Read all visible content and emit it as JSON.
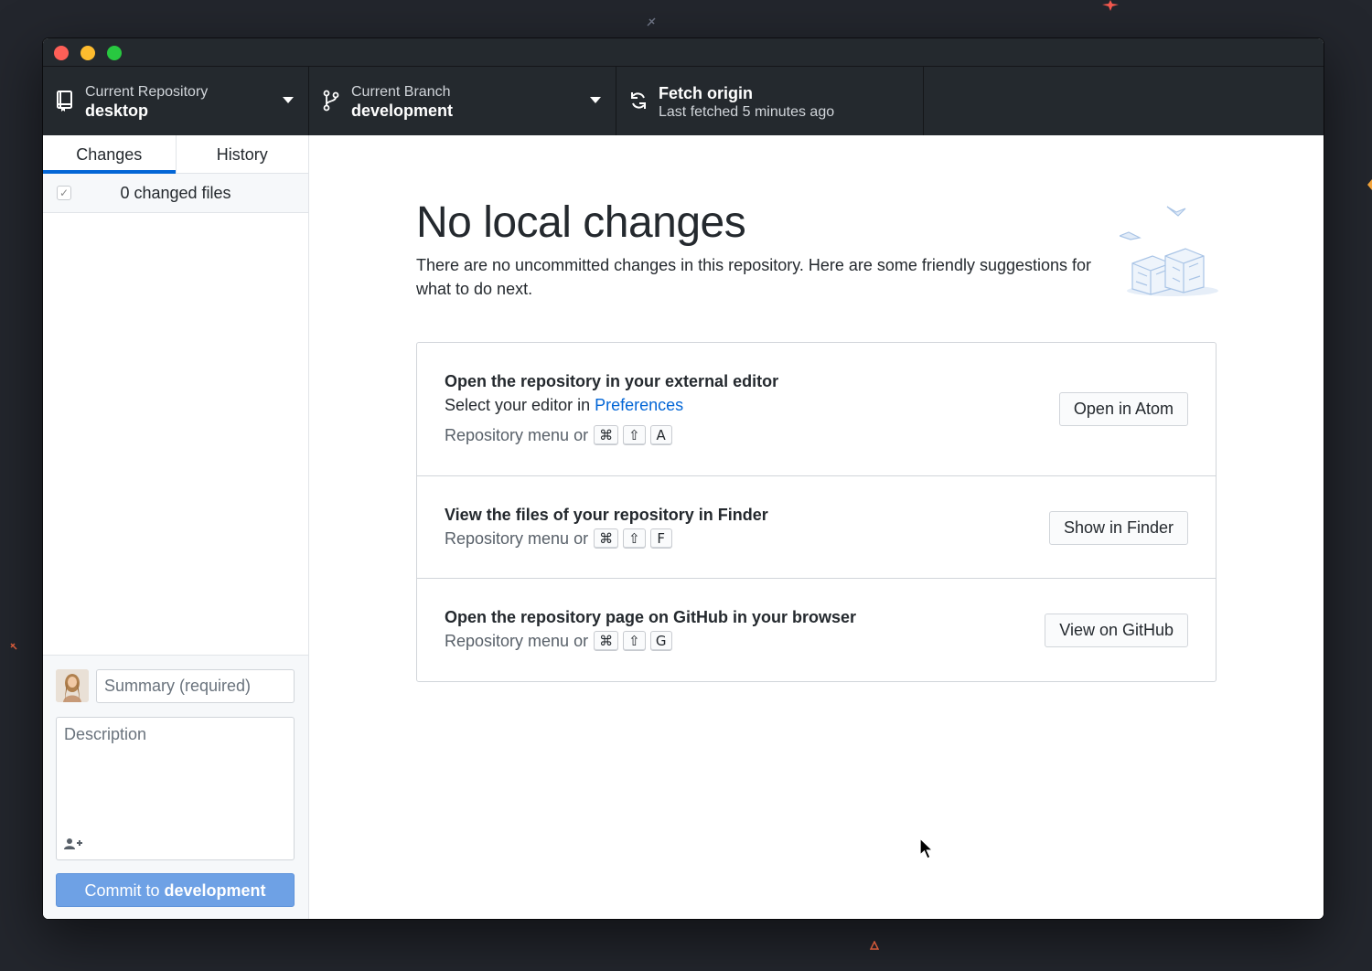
{
  "toolbar": {
    "repo": {
      "label": "Current Repository",
      "value": "desktop"
    },
    "branch": {
      "label": "Current Branch",
      "value": "development"
    },
    "fetch": {
      "label": "Fetch origin",
      "status": "Last fetched 5 minutes ago"
    }
  },
  "sidebar": {
    "tabs": [
      {
        "label": "Changes",
        "active": true
      },
      {
        "label": "History",
        "active": false
      }
    ],
    "changed_files": "0 changed files",
    "summary_placeholder": "Summary (required)",
    "description_placeholder": "Description",
    "commit": {
      "prefix": "Commit to ",
      "branch": "development"
    }
  },
  "main": {
    "title": "No local changes",
    "subtitle": "There are no uncommitted changes in this repository. Here are some friendly suggestions for what to do next.",
    "shortcut_prefix": "Repository menu or",
    "actions": [
      {
        "title": "Open the repository in your external editor",
        "line_prefix": "Select your editor in ",
        "line_link": "Preferences",
        "keys": [
          "⌘",
          "⇧",
          "A"
        ],
        "button": "Open in Atom"
      },
      {
        "title": "View the files of your repository in Finder",
        "keys": [
          "⌘",
          "⇧",
          "F"
        ],
        "button": "Show in Finder"
      },
      {
        "title": "Open the repository page on GitHub in your browser",
        "keys": [
          "⌘",
          "⇧",
          "G"
        ],
        "button": "View on GitHub"
      }
    ]
  },
  "colors": {
    "accent": "#0366d6",
    "toolbar_bg": "#24292e",
    "commit_button": "#6ea1e5",
    "desktop_bg": "#23262d"
  },
  "icons": {
    "repo": "repo-icon",
    "branch": "git-branch-icon",
    "fetch": "sync-icon",
    "coauthor": "person-add-icon"
  }
}
